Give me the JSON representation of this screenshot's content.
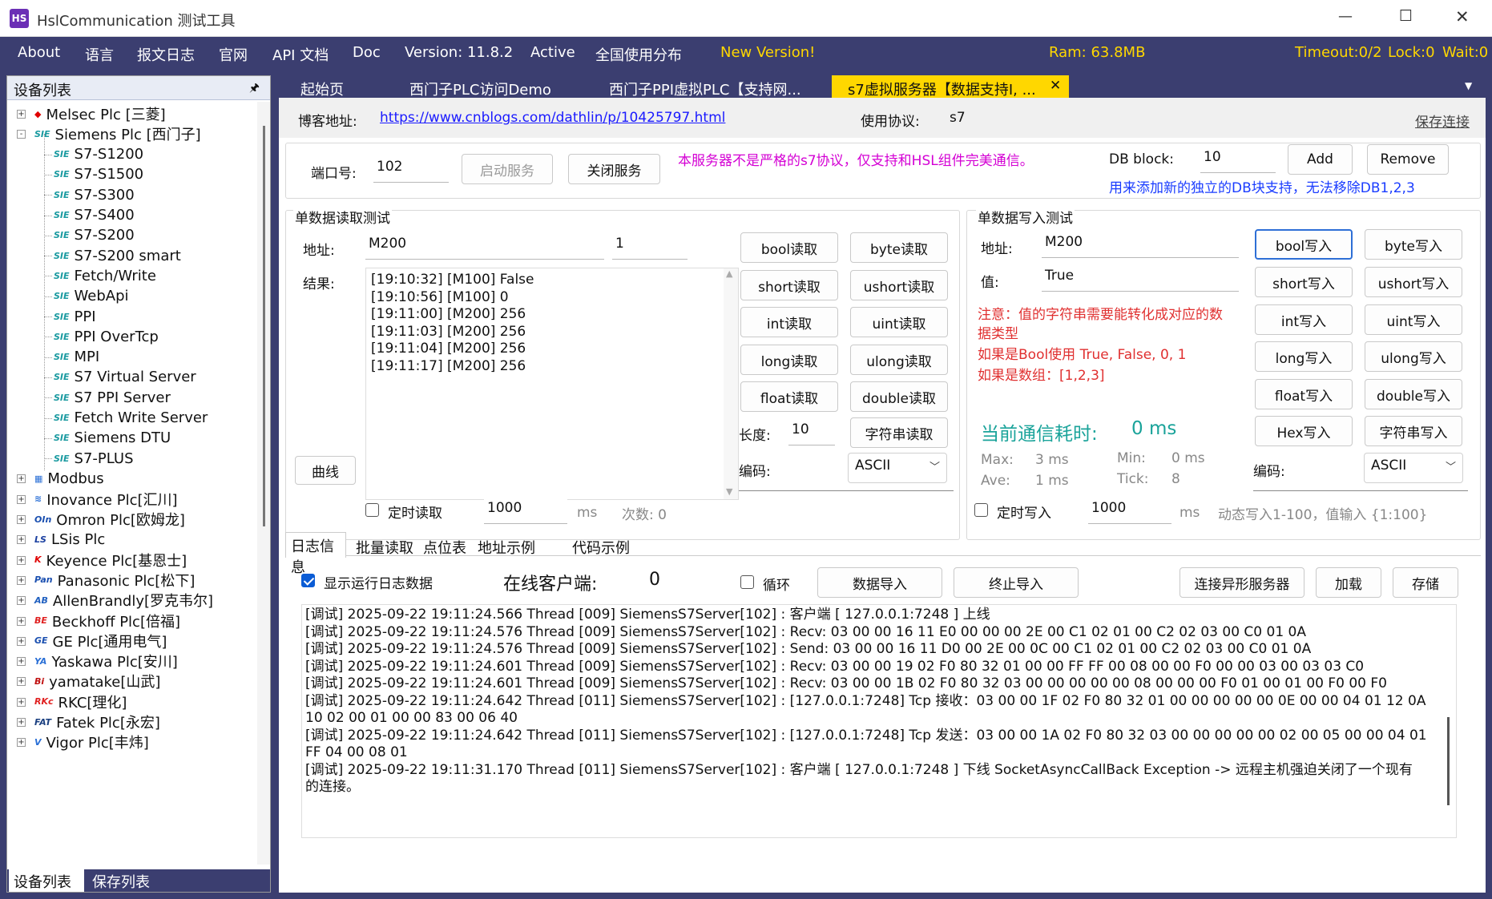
{
  "window": {
    "title": "HslCommunication 测试工具",
    "min": "—",
    "max": "☐",
    "close": "✕"
  },
  "menubar": {
    "items": [
      "About",
      "语言",
      "报文日志",
      "官网",
      "API 文档",
      "Doc",
      "Version: 11.8.2",
      "Active",
      "全国使用分布"
    ],
    "new_version": "New Version!",
    "ram": "Ram: 63.8MB",
    "timeout": "Timeout:0/2",
    "lock": "Lock:0",
    "wait": "Wait:0"
  },
  "sidebar": {
    "title": "设备列表",
    "pin": "🖈",
    "bottom_tabs": [
      "设备列表",
      "保存列表"
    ],
    "items": [
      {
        "label": "Melsec Plc [三菱]",
        "icon": "mitsubishi-icon",
        "level": 0,
        "exp": "+"
      },
      {
        "label": "Siemens Plc [西门子]",
        "icon": "siemens-icon",
        "level": 0,
        "exp": "-"
      },
      {
        "label": "S7-S1200",
        "icon": "siemens-icon",
        "level": 1
      },
      {
        "label": "S7-S1500",
        "icon": "siemens-icon",
        "level": 1
      },
      {
        "label": "S7-S300",
        "icon": "siemens-icon",
        "level": 1
      },
      {
        "label": "S7-S400",
        "icon": "siemens-icon",
        "level": 1
      },
      {
        "label": "S7-S200",
        "icon": "siemens-icon",
        "level": 1
      },
      {
        "label": "S7-S200 smart",
        "icon": "siemens-icon",
        "level": 1
      },
      {
        "label": "Fetch/Write",
        "icon": "siemens-icon",
        "level": 1
      },
      {
        "label": "WebApi",
        "icon": "siemens-icon",
        "level": 1
      },
      {
        "label": "PPI",
        "icon": "siemens-icon",
        "level": 1
      },
      {
        "label": "PPI OverTcp",
        "icon": "siemens-icon",
        "level": 1
      },
      {
        "label": "MPI",
        "icon": "siemens-icon",
        "level": 1
      },
      {
        "label": "S7 Virtual Server",
        "icon": "siemens-icon",
        "level": 1
      },
      {
        "label": "S7 PPI Server",
        "icon": "siemens-icon",
        "level": 1
      },
      {
        "label": "Fetch Write Server",
        "icon": "siemens-icon",
        "level": 1
      },
      {
        "label": "Siemens DTU",
        "icon": "siemens-icon",
        "level": 1
      },
      {
        "label": "S7-PLUS",
        "icon": "siemens-icon",
        "level": 1
      },
      {
        "label": "Modbus",
        "icon": "modbus-icon",
        "level": 0,
        "exp": "+"
      },
      {
        "label": "Inovance Plc[汇川]",
        "icon": "inovance-icon",
        "level": 0,
        "exp": "+"
      },
      {
        "label": "Omron Plc[欧姆龙]",
        "icon": "omron-icon",
        "level": 0,
        "exp": "+"
      },
      {
        "label": "LSis Plc",
        "icon": "ls-icon",
        "level": 0,
        "exp": "+"
      },
      {
        "label": "Keyence Plc[基恩士]",
        "icon": "keyence-icon",
        "level": 0,
        "exp": "+"
      },
      {
        "label": "Panasonic Plc[松下]",
        "icon": "panasonic-icon",
        "level": 0,
        "exp": "+"
      },
      {
        "label": "AllenBrandly[罗克韦尔]",
        "icon": "allenbradley-icon",
        "level": 0,
        "exp": "+"
      },
      {
        "label": "Beckhoff Plc[倍福]",
        "icon": "beckhoff-icon",
        "level": 0,
        "exp": "+"
      },
      {
        "label": "GE Plc[通用电气]",
        "icon": "ge-icon",
        "level": 0,
        "exp": "+"
      },
      {
        "label": "Yaskawa Plc[安川]",
        "icon": "yaskawa-icon",
        "level": 0,
        "exp": "+"
      },
      {
        "label": "yamatake[山武]",
        "icon": "yamatake-icon",
        "level": 0,
        "exp": "+"
      },
      {
        "label": "RKC[理化]",
        "icon": "rkc-icon",
        "level": 0,
        "exp": "+"
      },
      {
        "label": "Fatek Plc[永宏]",
        "icon": "fatek-icon",
        "level": 0,
        "exp": "+"
      },
      {
        "label": "Vigor Plc[丰炜]",
        "icon": "vigor-icon",
        "level": 0,
        "exp": "+"
      }
    ]
  },
  "tabs": {
    "items": [
      "起始页",
      "西门子PLC访问Demo",
      "西门子PPI虚拟PLC【支持网...",
      "s7虚拟服务器【数据支持I, ..."
    ],
    "active": 3,
    "close": "✕",
    "dropdown": "▼"
  },
  "info": {
    "blog_label": "博客地址:",
    "blog_url": "https://www.cnblogs.com/dathlin/p/10425797.html",
    "protocol_label": "使用协议:",
    "protocol": "s7",
    "save_conn": "保存连接"
  },
  "server": {
    "port_label": "端口号:",
    "port": "102",
    "start": "启动服务",
    "stop": "关闭服务",
    "note": "本服务器不是严格的s7协议，仅支持和HSL组件完美通信。",
    "db_label": "DB block:",
    "db_value": "10",
    "add": "Add",
    "remove": "Remove",
    "db_note": "用来添加新的独立的DB块支持，无法移除DB1,2,3"
  },
  "read": {
    "group": "单数据读取测试",
    "addr_label": "地址:",
    "addr": "M200",
    "count": "1",
    "result_label": "结果:",
    "results": [
      "[19:10:32] [M100] False",
      "[19:10:56] [M100] 0",
      "[19:11:00] [M200] 256",
      "[19:11:03] [M200] 256",
      "[19:11:04] [M200] 256",
      "[19:11:17] [M200] 256"
    ],
    "buttons": [
      "bool读取",
      "byte读取",
      "short读取",
      "ushort读取",
      "int读取",
      "uint读取",
      "long读取",
      "ulong读取",
      "float读取",
      "double读取"
    ],
    "len_label": "长度:",
    "len": "10",
    "str_btn": "字符串读取",
    "enc_label": "编码:",
    "enc": "ASCII",
    "curve": "曲线",
    "timer_label": "定时读取",
    "interval": "1000",
    "ms": "ms",
    "count_label": "次数: 0"
  },
  "write": {
    "group": "单数据写入测试",
    "addr_label": "地址:",
    "addr": "M200",
    "value_label": "值:",
    "value": "True",
    "note1": "注意：值的字符串需要能转化成对应的数",
    "note2": "据类型",
    "note3": "如果是Bool使用 True, False, 0, 1",
    "note4": "如果是数组：[1,2,3]",
    "buttons": [
      "bool写入",
      "byte写入",
      "short写入",
      "ushort写入",
      "int写入",
      "uint写入",
      "long写入",
      "ulong写入",
      "float写入",
      "double写入",
      "Hex写入",
      "字符串写入"
    ],
    "time_label": "当前通信耗时:",
    "time_value": "0 ms",
    "max_label": "Max:",
    "max": "3 ms",
    "min_label": "Min:",
    "min": "0 ms",
    "ave_label": "Ave:",
    "ave": "1 ms",
    "tick_label": "Tick:",
    "tick": "8",
    "enc_label": "编码:",
    "enc": "ASCII",
    "timer_label": "定时写入",
    "interval": "1000",
    "ms": "ms",
    "dyn_label": "动态写入1-100，值输入 {1:100}"
  },
  "bottom": {
    "tabs": [
      "日志信息",
      "批量读取",
      "点位表",
      "地址示例",
      "代码示例"
    ],
    "show_log": "显示运行日志数据",
    "online_label": "在线客户端:",
    "online": "0",
    "loop": "循环",
    "import": "数据导入",
    "stop_import": "终止导入",
    "connect_alien": "连接异形服务器",
    "load": "加载",
    "save": "存储",
    "log": [
      "[调试] 2025-09-22 19:11:24.566 Thread [009] SiemensS7Server[102] : 客户端 [ 127.0.0.1:7248 ] 上线",
      "[调试] 2025-09-22 19:11:24.576 Thread [009] SiemensS7Server[102] : Recv: 03 00 00 16 11 E0 00 00 00 2E 00 C1 02 01 00 C2 02 03 00 C0 01 0A",
      "[调试] 2025-09-22 19:11:24.576 Thread [009] SiemensS7Server[102] : Send: 03 00 00 16 11 D0 00 2E 00 0C 00 C1 02 01 00 C2 02 03 00 C0 01 0A",
      "[调试] 2025-09-22 19:11:24.601 Thread [009] SiemensS7Server[102] : Recv: 03 00 00 19 02 F0 80 32 01 00 00 FF FF 00 08 00 00 F0 00 00 03 00 03 03 C0",
      "[调试] 2025-09-22 19:11:24.601 Thread [009] SiemensS7Server[102] : Recv: 03 00 00 1B 02 F0 80 32 03 00 00 00 00 00 08 00 00 00 F0 01 00 01 00 F0 00 F0",
      "[调试] 2025-09-22 19:11:24.642 Thread [011] SiemensS7Server[102] : [127.0.0.1:7248] Tcp 接收：03 00 00 1F 02 F0 80 32 01 00 00 00 00 00 0E 00 00 04 01 12 0A",
      "10 02 00 01 00 00 83 00 06 40",
      "[调试] 2025-09-22 19:11:24.642 Thread [011] SiemensS7Server[102] : [127.0.0.1:7248] Tcp 发送：03 00 00 1A 02 F0 80 32 03 00 00 00 00 00 02 00 05 00 00 04 01",
      "FF 04 00 08 01",
      "[调试] 2025-09-22 19:11:31.170 Thread [011] SiemensS7Server[102] : 客户端 [ 127.0.0.1:7248 ] 下线 SocketAsyncCallBack Exception -> 远程主机强迫关闭了一个现有",
      "的连接。"
    ]
  },
  "colors": {
    "menubar": "#3b3e70",
    "new_version": "#ffd700",
    "ram": "#ffd700",
    "accent_blue": "#0b5cd5",
    "red_note": "#e03030",
    "magenta_note": "#d400d4",
    "db_note": "#1a3cff",
    "teal": "#1aa39a"
  }
}
